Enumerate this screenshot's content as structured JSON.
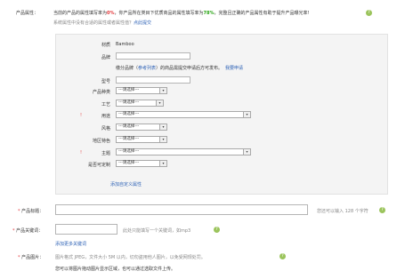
{
  "header": {
    "label": "产品属性：",
    "line1_a": "当前的产品的属性填写率为",
    "fill_rate": "0%",
    "line1_b": "，你产品所在类目下优质商品的属性填写率为",
    "quality_rate": "78%",
    "line1_c": "，完整且正确的产品属性有助于提升产品曝光率!",
    "line2_a": "系统属性中没有合适的属性或者属性值？",
    "line2_link": "点此提交"
  },
  "attributes": {
    "material_label": "材质",
    "material_value": "Bamboo",
    "brand_label": "品牌",
    "brand_hint_a": "缴分品牌（",
    "brand_hint_link": "参考列表",
    "brand_hint_b": "）的商品需提交申请后方可发布。",
    "brand_apply_link": "我要申请",
    "model_label": "型号",
    "type_label": "产品种类",
    "craft_label": "工艺",
    "usage_label": "用途",
    "style_label": "风格",
    "region_label": "地区特色",
    "theme_label": "主题",
    "customizable_label": "是否可定制",
    "select_placeholder": "---请选择---",
    "add_custom_link": "添加自定义属性"
  },
  "title_field": {
    "label": "产品标题：",
    "counter_a": "您还可以输入",
    "counter_num": "128",
    "counter_b": "个字符"
  },
  "keyword_field": {
    "label": "产品关键词：",
    "hint": "此处只能填写一个关键词，如mp3",
    "add_more": "添加更多关键词"
  },
  "image_field": {
    "label": "产品图片：",
    "hint1": "图片格式 JPEG，文件大小 5M 以内，切勿盗用他人图片，以免受网规处罚。",
    "hint2": "您可以将图片拖动图片显示区域，也可以通过选取文件上传。"
  },
  "icons": {
    "help": "help-icon",
    "dropdown": "chevron-down-icon"
  },
  "colors": {
    "rate_zero": "#e4393c",
    "rate_quality": "#2aa515",
    "link": "#2f63b6",
    "required_star": "#e4393c"
  }
}
